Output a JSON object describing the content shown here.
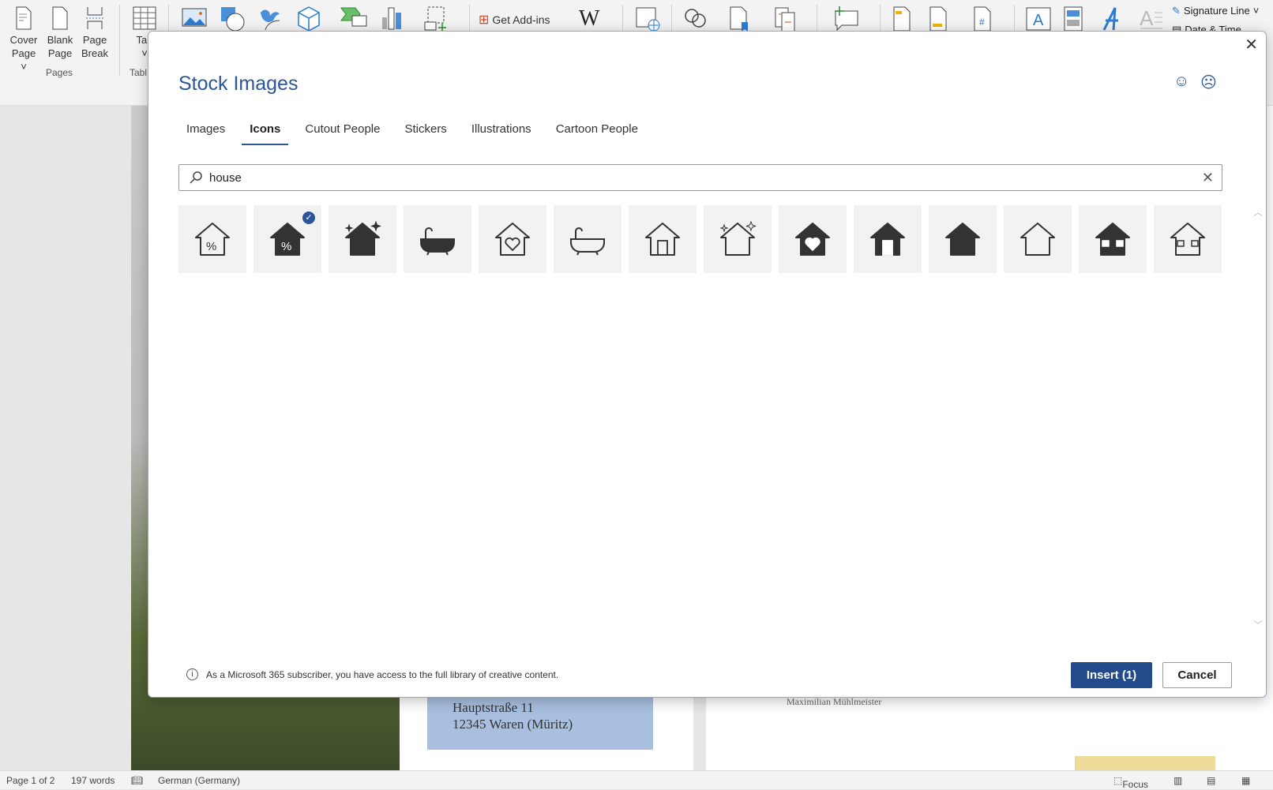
{
  "ribbon": {
    "buttons": [
      {
        "label1": "Cover",
        "label2": "Page ˅"
      },
      {
        "label1": "Blank",
        "label2": "Page"
      },
      {
        "label1": "Page",
        "label2": "Break"
      },
      {
        "label1": "Tab",
        "label2": "˅"
      }
    ],
    "groups": {
      "pages": "Pages",
      "tables": "Tabl"
    },
    "get_addins": "Get Add-ins",
    "wikipedia": "W",
    "signature_line": "Signature Line",
    "date_time": "Date & Time"
  },
  "document": {
    "address_line1": "Hauptstraße 11",
    "address_line2": "12345 Waren (Müritz)",
    "name": "Maximilian Mühlmeister"
  },
  "status": {
    "page": "Page 1 of 2",
    "words": "197 words",
    "language": "German (Germany)",
    "focus": "Focus"
  },
  "dialog": {
    "title": "Stock Images",
    "tabs": [
      {
        "label": "Images"
      },
      {
        "label": "Icons",
        "active": true
      },
      {
        "label": "Cutout People"
      },
      {
        "label": "Stickers"
      },
      {
        "label": "Illustrations"
      },
      {
        "label": "Cartoon People"
      }
    ],
    "search": {
      "value": "house",
      "placeholder": "Search"
    },
    "icons": [
      {
        "name": "house-percent-outline-icon",
        "selected": false
      },
      {
        "name": "house-percent-filled-icon",
        "selected": true
      },
      {
        "name": "house-sparkle-filled-icon",
        "selected": false
      },
      {
        "name": "bathtub-filled-icon",
        "selected": false
      },
      {
        "name": "house-heart-outline-icon",
        "selected": false
      },
      {
        "name": "bathtub-outline-icon",
        "selected": false
      },
      {
        "name": "house-door-outline-icon",
        "selected": false
      },
      {
        "name": "house-sparkle-outline-icon",
        "selected": false
      },
      {
        "name": "house-heart-filled-icon",
        "selected": false
      },
      {
        "name": "house-door-filled-icon",
        "selected": false
      },
      {
        "name": "house-filled-icon",
        "selected": false
      },
      {
        "name": "house-outline-icon",
        "selected": false
      },
      {
        "name": "house-windows-filled-icon",
        "selected": false
      },
      {
        "name": "house-windows-outline-icon",
        "selected": false
      }
    ],
    "footer_note": "As a Microsoft 365 subscriber, you have access to the full library of creative content.",
    "insert_label": "Insert (1)",
    "cancel_label": "Cancel",
    "accent": "#2b579a"
  }
}
